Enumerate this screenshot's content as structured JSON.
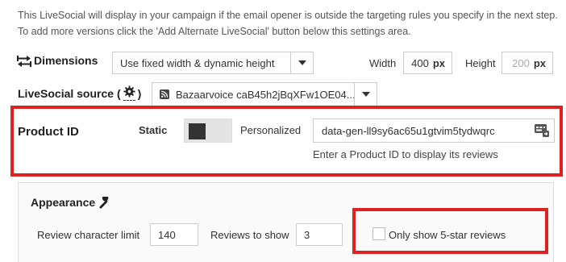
{
  "intro_text": "This LiveSocial will display in your campaign if the email opener is outside the targeting rules you specify in the next step. To add more versions click the 'Add Alternate LiveSocial' button below this settings area.",
  "dimensions": {
    "label": "Dimensions",
    "mode": "Use fixed width & dynamic height",
    "width_label": "Width",
    "width_value": "400",
    "width_unit": "px",
    "height_label": "Height",
    "height_value": "200",
    "height_unit": "px"
  },
  "source": {
    "label_prefix": "LiveSocial source (",
    "label_suffix": ")",
    "value": "Bazaarvoice caB45h2jBqXFw1OE04..."
  },
  "product": {
    "label": "Product ID",
    "static_label": "Static",
    "personalized_label": "Personalized",
    "value": "data-gen-ll9sy6ac65u1gtvim5tydwqrc",
    "hint": "Enter a Product ID to display its reviews"
  },
  "appearance": {
    "title": "Appearance",
    "char_limit_label": "Review character limit",
    "char_limit_value": "140",
    "reviews_label": "Reviews to show",
    "reviews_value": "3",
    "five_star_label": "Only show 5-star reviews"
  },
  "colors": {
    "highlight": "#dd2222"
  }
}
